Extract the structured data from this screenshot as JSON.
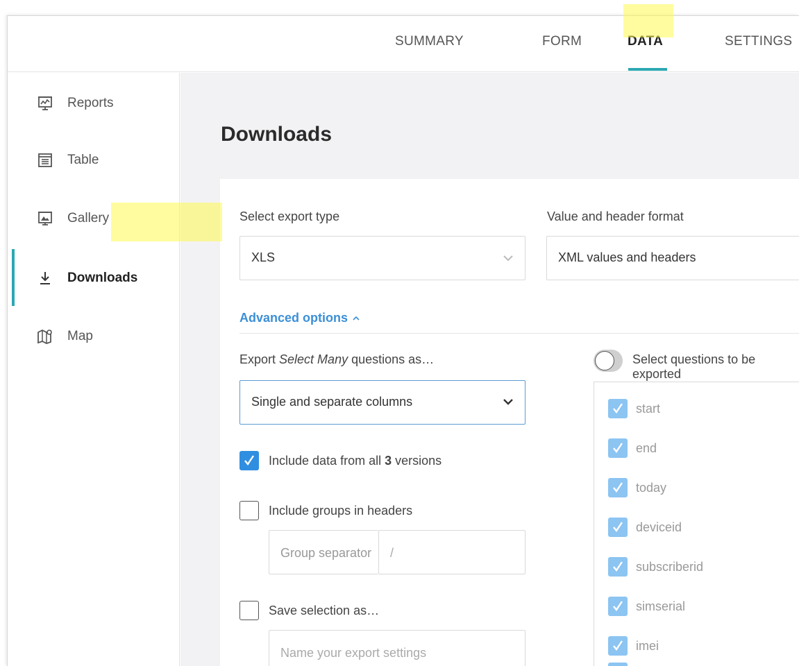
{
  "heading_cut": "Exp",
  "tabs": [
    {
      "label": "SUMMARY",
      "active": false
    },
    {
      "label": "FORM",
      "active": false
    },
    {
      "label": "DATA",
      "active": true
    },
    {
      "label": "SETTINGS",
      "active": false
    }
  ],
  "sidebar": {
    "items": [
      {
        "label": "Reports",
        "icon": "reports-icon",
        "active": false
      },
      {
        "label": "Table",
        "icon": "table-icon",
        "active": false
      },
      {
        "label": "Gallery",
        "icon": "gallery-icon",
        "active": false
      },
      {
        "label": "Downloads",
        "icon": "download-icon",
        "active": true
      },
      {
        "label": "Map",
        "icon": "map-icon",
        "active": false
      }
    ]
  },
  "main": {
    "title": "Downloads",
    "export_type": {
      "label": "Select export type",
      "value": "XLS"
    },
    "value_format": {
      "label": "Value and header format",
      "value": "XML values and headers"
    },
    "advanced_options": "Advanced options",
    "select_many": {
      "label_prefix": "Export ",
      "label_em": "Select Many",
      "label_suffix": " questions as…",
      "value": "Single and separate columns"
    },
    "include_versions": {
      "prefix": "Include data from all ",
      "count": "3",
      "suffix": " versions",
      "checked": true
    },
    "include_groups": {
      "label": "Include groups in headers",
      "checked": false
    },
    "group_separator": {
      "label": "Group separator",
      "value": "/"
    },
    "save_selection": {
      "label": "Save selection as…",
      "checked": false,
      "placeholder": "Name your export settings"
    },
    "select_questions": {
      "label": "Select questions to be exported",
      "enabled": false
    },
    "questions": [
      "start",
      "end",
      "today",
      "deviceid",
      "subscriberid",
      "simserial",
      "imei"
    ]
  },
  "colors": {
    "accent": "#2ca8b2",
    "link": "#3b8fd6",
    "checkbox": "#2f8ee0",
    "highlight": "#fffa50"
  }
}
